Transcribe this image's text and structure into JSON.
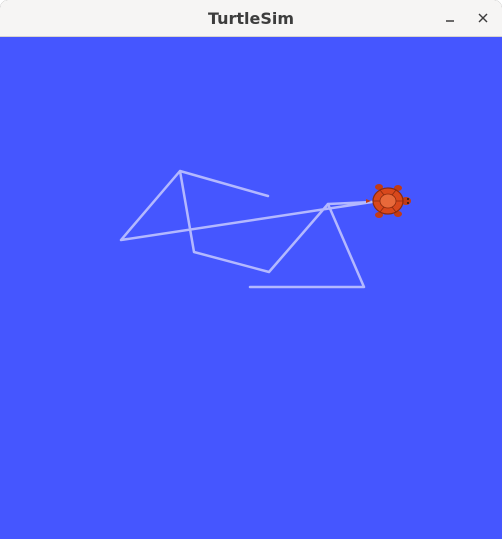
{
  "window": {
    "title": "TurtleSim",
    "controls": [
      {
        "name": "minimize-button",
        "icon": "minimize-icon"
      },
      {
        "name": "close-button",
        "icon": "close-icon"
      }
    ]
  },
  "canvas": {
    "background_color": "#4556ff",
    "pen_color": "#b3b8ff",
    "turtle": {
      "icon": "turtle-icon",
      "heading": "east",
      "shell_color": "#d9481c",
      "body_color": "#e06030"
    }
  }
}
